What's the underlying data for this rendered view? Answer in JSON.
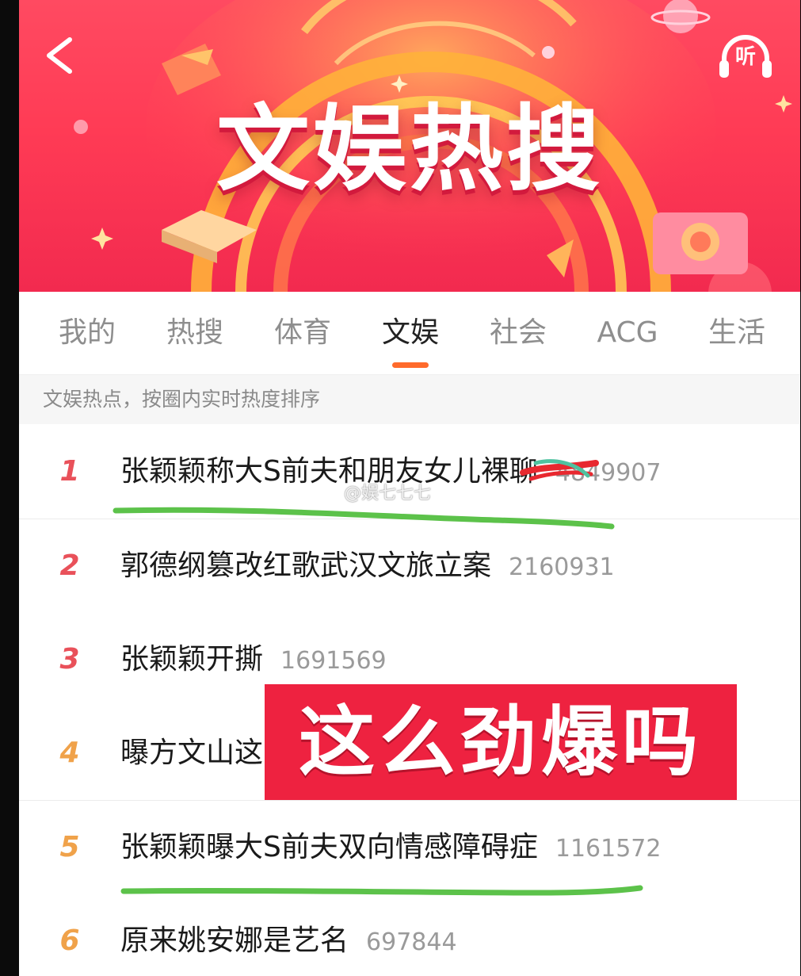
{
  "banner": {
    "title": "文娱热搜",
    "listen_label": "听"
  },
  "tabs": [
    {
      "label": "我的",
      "active": false
    },
    {
      "label": "热搜",
      "active": false
    },
    {
      "label": "体育",
      "active": false
    },
    {
      "label": "文娱",
      "active": true
    },
    {
      "label": "社会",
      "active": false
    },
    {
      "label": "ACG",
      "active": false
    },
    {
      "label": "生活",
      "active": false
    }
  ],
  "subheader": "文娱热点，按圈内实时热度排序",
  "list": [
    {
      "rank": "1",
      "title": "张颖颖称大S前夫和朋友女儿裸聊",
      "count": "4849907"
    },
    {
      "rank": "2",
      "title": "郭德纲篡改红歌武汉文旅立案",
      "count": "2160931"
    },
    {
      "rank": "3",
      "title": "张颖颖开撕",
      "count": "1691569"
    },
    {
      "rank": "4",
      "title": "曝方文山这",
      "count": ""
    },
    {
      "rank": "5",
      "title": "张颖颖曝大S前夫双向情感障碍症",
      "count": "1161572"
    },
    {
      "rank": "6",
      "title": "原来姚安娜是艺名",
      "count": "697844"
    }
  ],
  "overlay": {
    "caption": "这么劲爆吗",
    "watermark": "@娱七七七"
  },
  "colors": {
    "rank_top": "#e9515a",
    "rank_other": "#f0a24a",
    "accent": "#ff6a2b",
    "marker_green": "#5cc24a",
    "caption_bg": "#ee2240"
  }
}
